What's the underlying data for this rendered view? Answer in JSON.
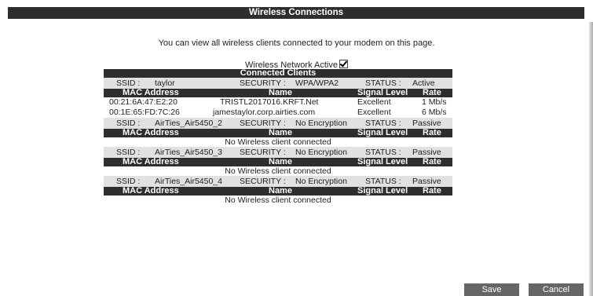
{
  "page": {
    "title": "Wireless Connections",
    "intro": "You can view all wireless clients connected to your modem on this page.",
    "wireless_active_label": "Wireless Network Active",
    "wireless_active_checked": true,
    "connected_clients_title": "Connected Clients"
  },
  "labels": {
    "ssid": "SSID :",
    "security": "SECURITY :",
    "status": "STATUS :",
    "col_mac": "MAC Address",
    "col_name": "Name",
    "col_signal": "Signal Level",
    "col_rate": "Rate"
  },
  "networks": [
    {
      "ssid": "taylor",
      "security": "WPA/WPA2",
      "status": "Active",
      "clients": [
        {
          "mac": "00:21:6A:47:E2:20",
          "name": "TRISTL2017016.KRFT.Net",
          "signal": "Excellent",
          "rate": "1 Mb/s"
        },
        {
          "mac": "00:1E:65:FD:7C:26",
          "name": "jamestaylor.corp.airties.com",
          "signal": "Excellent",
          "rate": "6 Mb/s"
        }
      ],
      "empty_text": ""
    },
    {
      "ssid": "AirTies_Air5450_2",
      "security": "No Encryption",
      "status": "Passive",
      "clients": [],
      "empty_text": "No Wireless client connected"
    },
    {
      "ssid": "AirTies_Air5450_3",
      "security": "No Encryption",
      "status": "Passive",
      "clients": [],
      "empty_text": "No Wireless client connected"
    },
    {
      "ssid": "AirTies_Air5450_4",
      "security": "No Encryption",
      "status": "Passive",
      "clients": [],
      "empty_text": "No Wireless client connected"
    }
  ],
  "buttons": {
    "save": "Save",
    "cancel": "Cancel"
  },
  "colors": {
    "header_bar": "#2e2e2e",
    "ssid_row": "#e1e1e1",
    "button": "#666666"
  }
}
